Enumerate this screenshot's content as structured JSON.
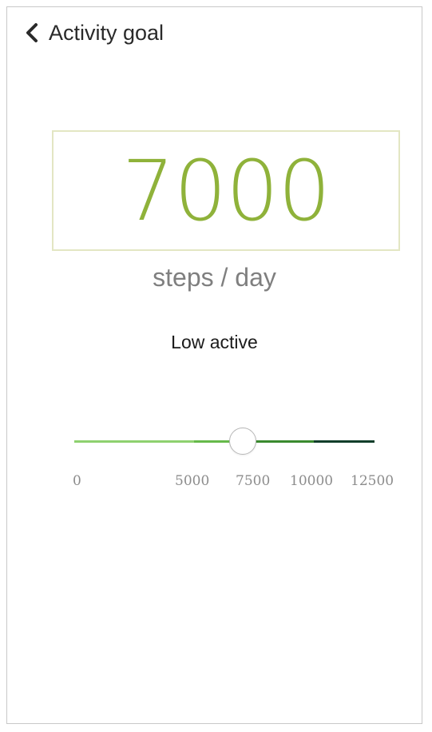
{
  "header": {
    "title": "Activity goal",
    "back_icon": "chevron-left-icon"
  },
  "goal": {
    "value": "7000",
    "unit": "steps / day",
    "level_label": "Low active",
    "accent_color": "#8fb23a",
    "box_border_color": "#e3e6c3"
  },
  "slider": {
    "min": 0,
    "max": 12500,
    "value": 7000,
    "tick_labels": [
      "0",
      "5000",
      "7500",
      "10000",
      "12500"
    ],
    "segment_colors": [
      "#8ed16f",
      "#66b94a",
      "#3a8a2e",
      "#0f3d2a"
    ]
  }
}
